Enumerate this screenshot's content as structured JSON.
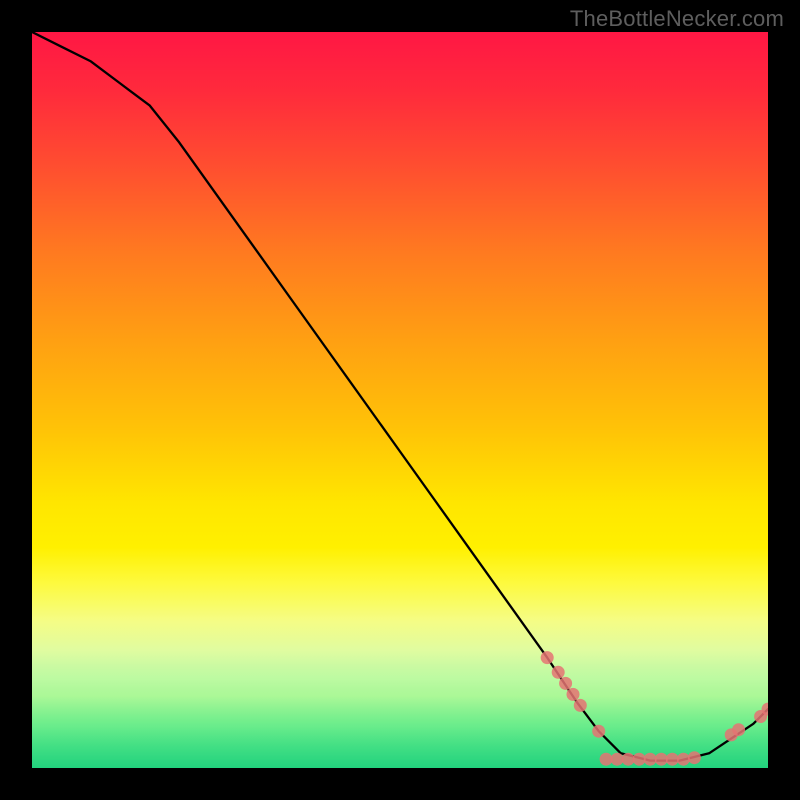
{
  "watermark": "TheBottleNecker.com",
  "chart_data": {
    "type": "line",
    "title": "",
    "xlabel": "",
    "ylabel": "",
    "xlim": [
      0,
      100
    ],
    "ylim": [
      0,
      100
    ],
    "series": [
      {
        "name": "curve",
        "x": [
          0,
          4,
          8,
          12,
          16,
          20,
          25,
          30,
          35,
          40,
          45,
          50,
          55,
          60,
          65,
          70,
          74,
          77,
          80,
          84,
          88,
          92,
          95,
          98,
          100
        ],
        "y": [
          100,
          98,
          96,
          93,
          90,
          85,
          78,
          71,
          64,
          57,
          50,
          43,
          36,
          29,
          22,
          15,
          9,
          5,
          2,
          1,
          1,
          2,
          4,
          6,
          8
        ]
      }
    ],
    "markers": [
      {
        "x": 70.0,
        "y": 15.0
      },
      {
        "x": 71.5,
        "y": 13.0
      },
      {
        "x": 72.5,
        "y": 11.5
      },
      {
        "x": 73.5,
        "y": 10.0
      },
      {
        "x": 74.5,
        "y": 8.5
      },
      {
        "x": 77.0,
        "y": 5.0
      },
      {
        "x": 78.0,
        "y": 1.2
      },
      {
        "x": 79.5,
        "y": 1.2
      },
      {
        "x": 81.0,
        "y": 1.2
      },
      {
        "x": 82.5,
        "y": 1.2
      },
      {
        "x": 84.0,
        "y": 1.2
      },
      {
        "x": 85.5,
        "y": 1.2
      },
      {
        "x": 87.0,
        "y": 1.2
      },
      {
        "x": 88.5,
        "y": 1.2
      },
      {
        "x": 90.0,
        "y": 1.4
      },
      {
        "x": 95.0,
        "y": 4.5
      },
      {
        "x": 96.0,
        "y": 5.2
      },
      {
        "x": 99.0,
        "y": 7.0
      },
      {
        "x": 100.0,
        "y": 8.0
      }
    ],
    "colors": {
      "line": "#000000",
      "marker": "#e57373",
      "background_top": "#ff1744",
      "background_mid": "#ffe600",
      "background_bottom": "#18d37e"
    }
  }
}
